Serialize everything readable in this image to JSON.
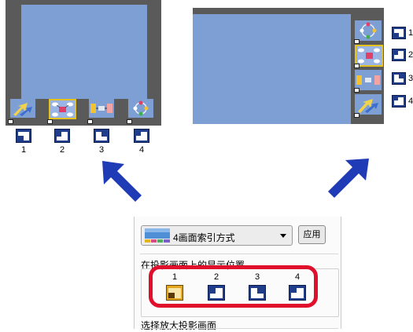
{
  "left_preview": {
    "thumbnail_labels": [
      "1",
      "2",
      "3",
      "4"
    ]
  },
  "right_preview": {
    "thumbnail_labels": [
      "1",
      "2",
      "3",
      "4"
    ]
  },
  "dialog": {
    "layout_combo": {
      "selected": "4画面索引方式",
      "icon": "four-screen-index-icon"
    },
    "apply_button": "应用",
    "display_position_label": "在投影画面上的显示位置",
    "positions": [
      "1",
      "2",
      "3",
      "4"
    ],
    "selected_position": "1",
    "enlarge_label": "选择放大投影画面"
  },
  "colors": {
    "highlight": "#e0102d",
    "arrow": "#1f3bb5",
    "screen_bg": "#5a5a5a",
    "screen_area": "#7d9fd4",
    "position_icon": "#1f3d8a",
    "selected_position_icon": "#e6a51f"
  }
}
